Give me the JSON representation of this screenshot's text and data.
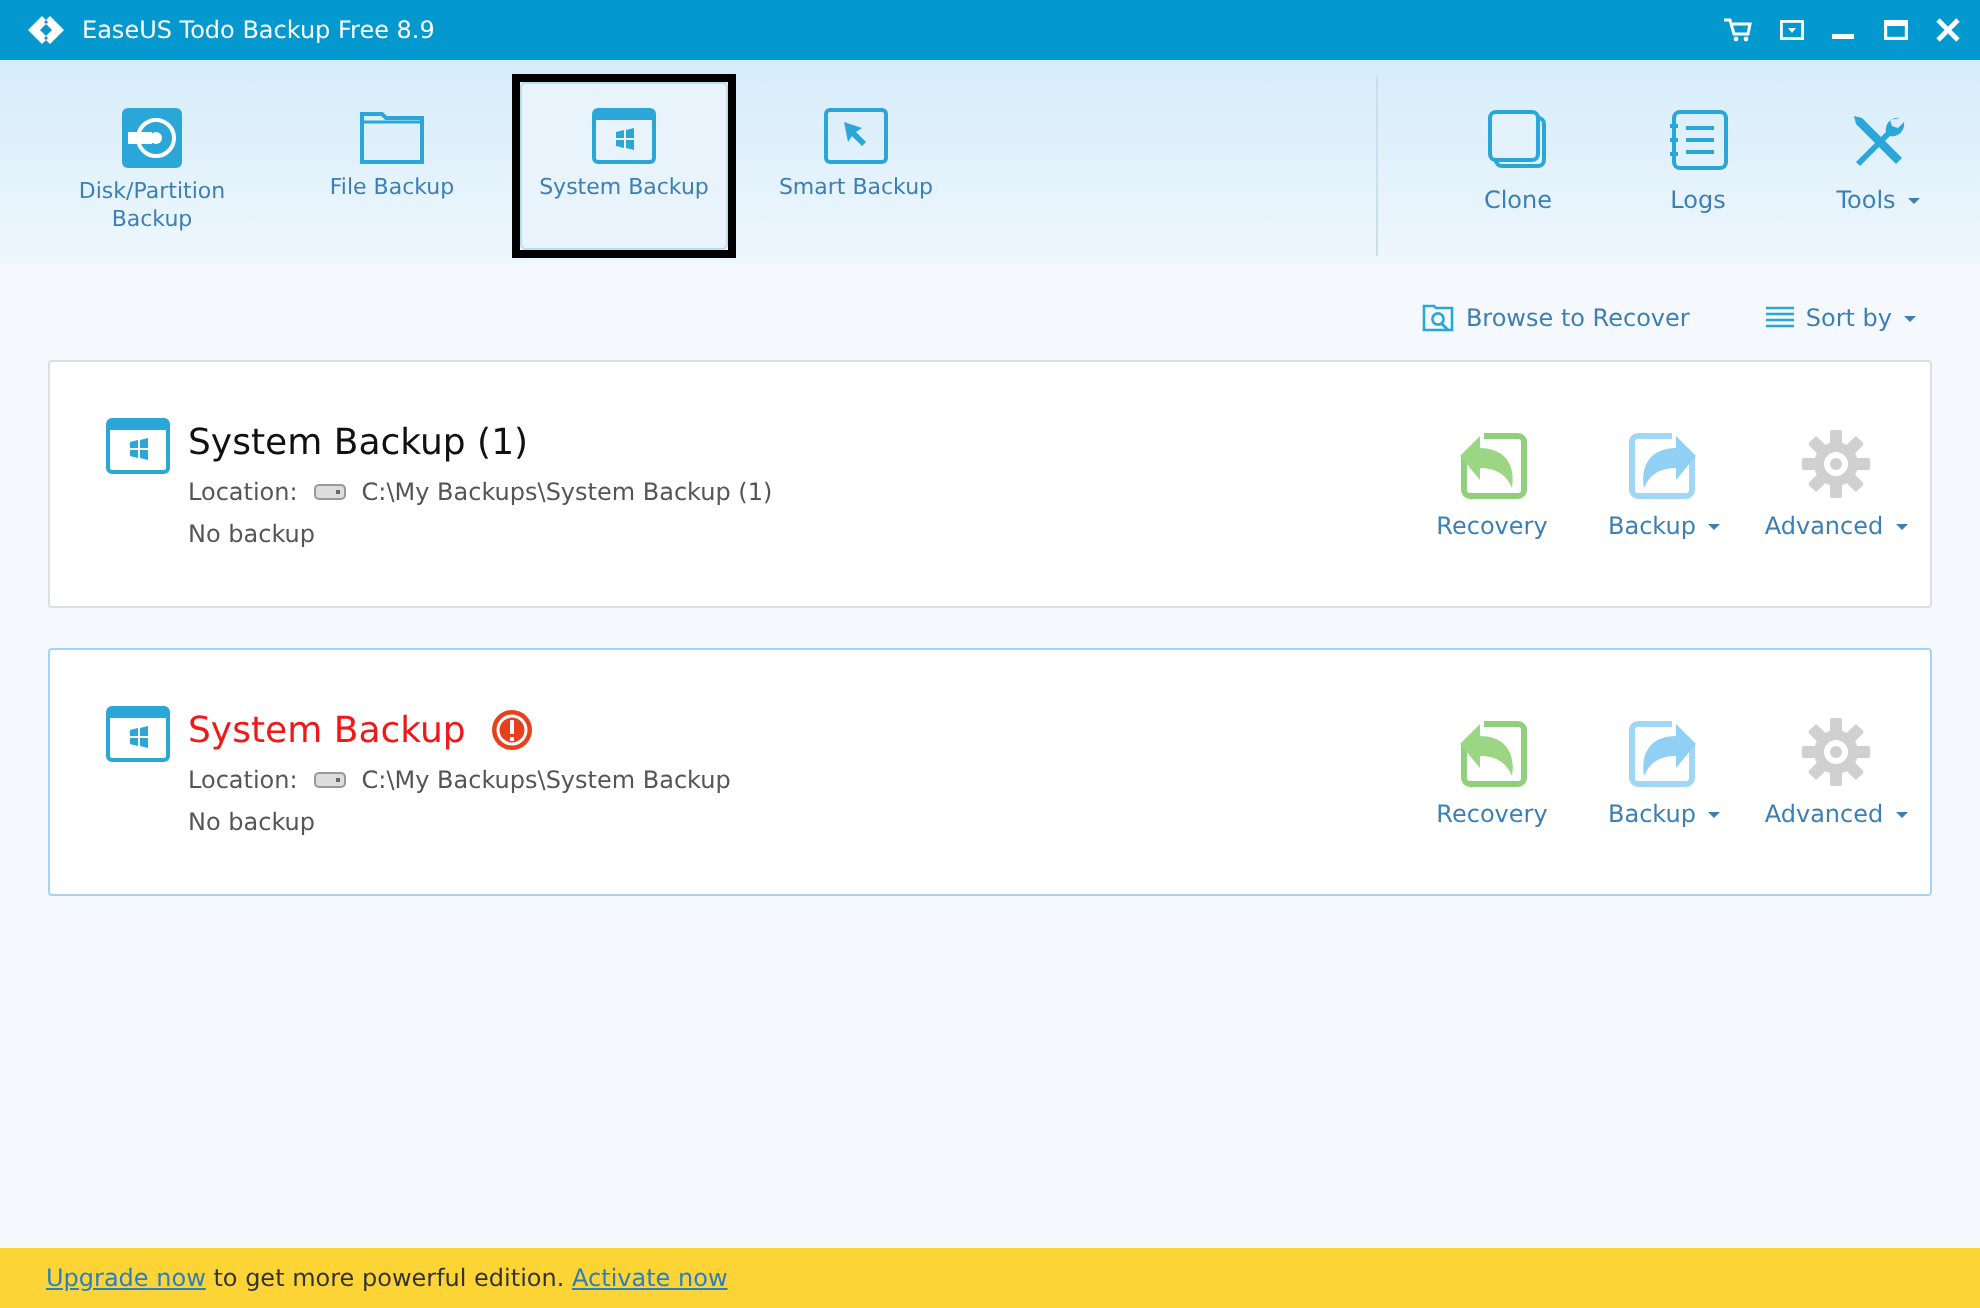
{
  "window": {
    "title": "EaseUS Todo Backup Free 8.9"
  },
  "toolbar": {
    "left": [
      {
        "kind": "disk",
        "label": "Disk/Partition Backup",
        "selected": false
      },
      {
        "kind": "file",
        "label": "File Backup",
        "selected": false
      },
      {
        "kind": "system",
        "label": "System Backup",
        "selected": true
      },
      {
        "kind": "smart",
        "label": "Smart Backup",
        "selected": false
      }
    ],
    "right": [
      {
        "kind": "clone",
        "label": "Clone",
        "has_menu": false
      },
      {
        "kind": "logs",
        "label": "Logs",
        "has_menu": false
      },
      {
        "kind": "tools",
        "label": "Tools",
        "has_menu": true
      }
    ]
  },
  "actions": [
    {
      "kind": "browse",
      "label": "Browse to Recover",
      "has_menu": false
    },
    {
      "kind": "sort",
      "label": "Sort by",
      "has_menu": true
    }
  ],
  "tasks": [
    {
      "title": "System Backup (1)",
      "alert": false,
      "selected": false,
      "location_label": "Location:",
      "location": "C:\\My Backups\\System Backup (1)",
      "summary": "No backup",
      "buttons": [
        {
          "kind": "recovery",
          "label": "Recovery",
          "has_menu": false
        },
        {
          "kind": "backup",
          "label": "Backup",
          "has_menu": true
        },
        {
          "kind": "advanced",
          "label": "Advanced",
          "has_menu": true
        }
      ]
    },
    {
      "title": "System Backup",
      "alert": true,
      "selected": true,
      "location_label": "Location:",
      "location": "C:\\My Backups\\System Backup",
      "summary": "No backup",
      "buttons": [
        {
          "kind": "recovery",
          "label": "Recovery",
          "has_menu": false
        },
        {
          "kind": "backup",
          "label": "Backup",
          "has_menu": true
        },
        {
          "kind": "advanced",
          "label": "Advanced",
          "has_menu": true
        }
      ]
    }
  ],
  "footer": [
    {
      "kind": "link",
      "text": "Upgrade now"
    },
    {
      "kind": "text",
      "text": " to get more powerful edition. "
    },
    {
      "kind": "link",
      "text": "Activate now"
    }
  ]
}
